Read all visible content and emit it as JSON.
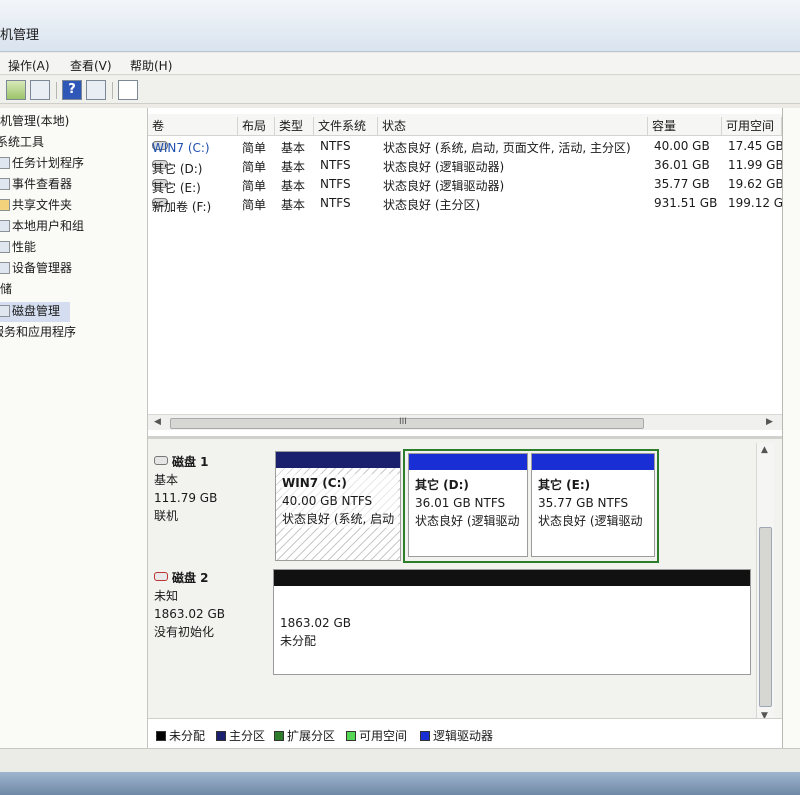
{
  "window": {
    "title": "机管理"
  },
  "menu": {
    "items": [
      "操作(A)",
      "查看(V)",
      "帮助(H)"
    ]
  },
  "toolbar": {
    "icons": [
      "up-arrow-icon",
      "show-hide-tree-icon",
      "help-icon",
      "properties-icon",
      "export-icon"
    ]
  },
  "tree": {
    "items": [
      {
        "label": "机管理(本地)",
        "icon": "computer-icon"
      },
      {
        "label": "系统工具",
        "icon": "tools-icon"
      },
      {
        "label": "任务计划程序",
        "icon": "clock-icon"
      },
      {
        "label": "事件查看器",
        "icon": "event-viewer-icon"
      },
      {
        "label": "共享文件夹",
        "icon": "folder-icon"
      },
      {
        "label": "本地用户和组",
        "icon": "users-icon"
      },
      {
        "label": "性能",
        "icon": "performance-icon"
      },
      {
        "label": "设备管理器",
        "icon": "device-manager-icon"
      },
      {
        "label": "存储",
        "icon": "storage-icon"
      },
      {
        "label": "磁盘管理",
        "icon": "disk-icon"
      },
      {
        "label": "服务和应用程序",
        "icon": "services-icon"
      }
    ]
  },
  "volumes": {
    "headers": [
      "卷",
      "布局",
      "类型",
      "文件系统",
      "状态",
      "容量",
      "可用空间"
    ],
    "rows": [
      {
        "name": "WIN7 (C:)",
        "layout": "简单",
        "type": "基本",
        "fs": "NTFS",
        "status": "状态良好 (系统, 启动, 页面文件, 活动, 主分区)",
        "capacity": "40.00 GB",
        "free": "17.45 GB"
      },
      {
        "name": "其它 (D:)",
        "layout": "简单",
        "type": "基本",
        "fs": "NTFS",
        "status": "状态良好 (逻辑驱动器)",
        "capacity": "36.01 GB",
        "free": "11.99 GB"
      },
      {
        "name": "其它 (E:)",
        "layout": "简单",
        "type": "基本",
        "fs": "NTFS",
        "status": "状态良好 (逻辑驱动器)",
        "capacity": "35.77 GB",
        "free": "19.62 GB"
      },
      {
        "name": "新加卷 (F:)",
        "layout": "简单",
        "type": "基本",
        "fs": "NTFS",
        "status": "状态良好 (主分区)",
        "capacity": "931.51 GB",
        "free": "199.12 G"
      }
    ],
    "scroll_grip": "III"
  },
  "disks": [
    {
      "name": "磁盘 1",
      "type": "基本",
      "size": "111.79 GB",
      "state": "联机",
      "partitions": [
        {
          "label": "WIN7  (C:)",
          "size": "40.00 GB NTFS",
          "status": "状态良好 (系统, 启动"
        },
        {
          "label": "其它  (D:)",
          "size": "36.01 GB NTFS",
          "status": "状态良好 (逻辑驱动"
        },
        {
          "label": "其它  (E:)",
          "size": "35.77 GB NTFS",
          "status": "状态良好 (逻辑驱动"
        }
      ]
    },
    {
      "name": "磁盘 2",
      "type": "未知",
      "size": "1863.02 GB",
      "state": "没有初始化",
      "partitions": [
        {
          "size": "1863.02 GB",
          "status": "未分配"
        }
      ]
    }
  ],
  "legend": [
    {
      "label": "未分配",
      "color": "#000000"
    },
    {
      "label": "主分区",
      "color": "#1a1f6e"
    },
    {
      "label": "扩展分区",
      "color": "#2d7d2d"
    },
    {
      "label": "可用空间",
      "color": "#55d655"
    },
    {
      "label": "逻辑驱动器",
      "color": "#1a2ed6"
    }
  ],
  "colors": {
    "primary": "#1a1f6e",
    "logical": "#1a2ed6",
    "extended": "#2d7d2d",
    "unallocated": "#000000"
  }
}
